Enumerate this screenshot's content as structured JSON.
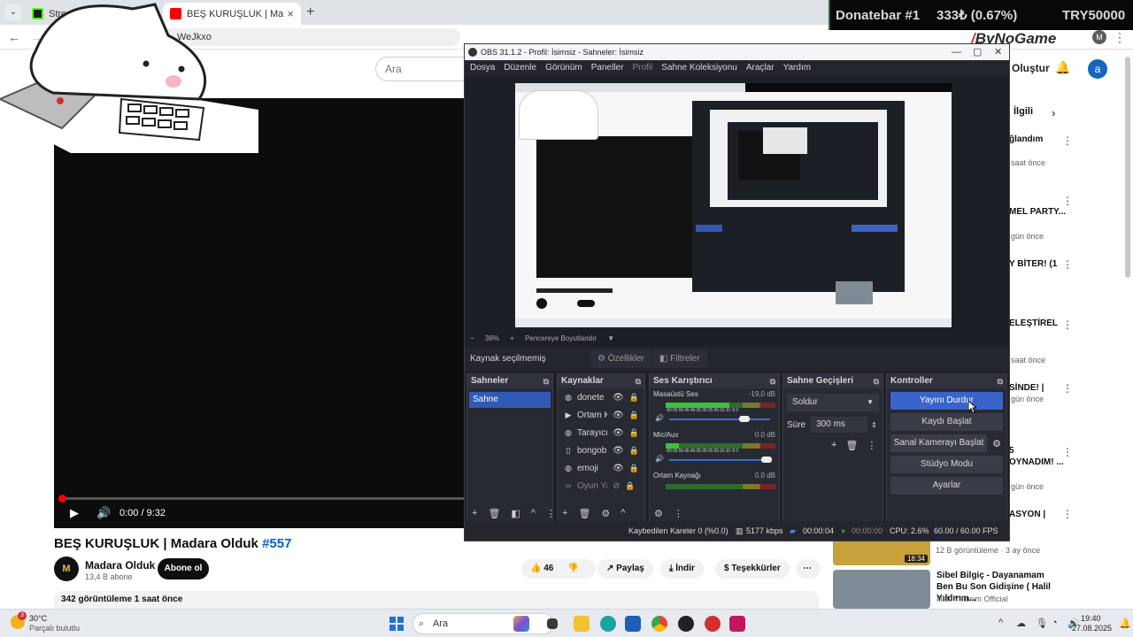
{
  "browser": {
    "tabs": [
      {
        "title": "Stream - Kick Dashboard"
      },
      {
        "title": "BEŞ KURUŞLUK | Madara Olduk"
      }
    ],
    "url_fragment": "WeJkxo"
  },
  "overlay": {
    "donate_label": "Donatebar #1",
    "donate_amount": "333₺ (0.67%)",
    "donate_goal": "TRY50000",
    "brand": "ByNoGame"
  },
  "youtube": {
    "search_placeholder": "Ara",
    "create_label": "Oluştur",
    "avatar_letter": "a",
    "video": {
      "time": "0:00 / 9:32",
      "title": "BEŞ KURUŞLUK | Madara Olduk ",
      "tag": "#557",
      "channel": "Madara Olduk",
      "subs": "13,4 B abone",
      "subscribe_label": "Abone ol",
      "likes": "46",
      "share": "Paylaş",
      "download": "İndir",
      "thanks": "Teşekkürler",
      "views": "342 görüntüleme  1 saat önce"
    },
    "sidebar": {
      "chip": "İlgili",
      "fragments": [
        "ğlandım",
        "saat önce",
        "MEL PARTY...",
        "gün önce",
        "Y BİTER! (1",
        "ELEŞTİREL",
        "saat önce",
        "SİNDE! |",
        "gün önce",
        "5",
        "OYNADIM! ...",
        "gün önce",
        "ASYON |"
      ],
      "rec1_duration": "18:34",
      "rec1_meta": "12 B görüntüleme · 3 ay önce",
      "rec2_title": "Sibel Bilgiç - Dayanamam Ben Bu Son Gidişine ( Halil Yıldırım...",
      "rec2_channel": "Halil Yıldırım Official"
    }
  },
  "obs": {
    "title": "OBS 31.1.2 - Profil: İsimsiz - Sahneler: İsimsiz",
    "menu": [
      "Dosya",
      "Düzenle",
      "Görünüm",
      "Paneller",
      "Profil",
      "Sahne Koleksiyonu",
      "Araçlar",
      "Yardım"
    ],
    "zoom": "38%",
    "fit_label": "Pencereye Boyutlandır",
    "no_source": "Kaynak seçilmemiş",
    "properties": "Özellikler",
    "filters": "Filtreler",
    "scenes_title": "Sahneler",
    "scene": "Sahne",
    "sources_title": "Kaynaklar",
    "sources": [
      "donete",
      "Ortam K",
      "Tarayıcı",
      "bongob",
      "emoji",
      "Oyun Ya"
    ],
    "mixer_title": "Ses Karıştırıcı",
    "mixer": [
      {
        "name": "Masaüstü Ses",
        "db": "-19,0 dB",
        "level": 0.58,
        "fader": 0.78
      },
      {
        "name": "Mic/Aux",
        "db": "0.0 dB",
        "level": 0.12,
        "fader": 0.98
      },
      {
        "name": "Ortam Kaynağı",
        "db": "0.0 dB",
        "level": 0.0,
        "fader": 0.98
      }
    ],
    "mixer_scale": "-60-55-50-45-40-35-30-25-20-15-10 -5  0",
    "transitions_title": "Sahne Geçişleri",
    "transition": "Soldur",
    "duration_label": "Süre",
    "duration": "300 ms",
    "controls_title": "Kontroller",
    "controls": [
      "Yayını Durdur",
      "Kaydı Başlat",
      "Sanal Kamerayı Başlat",
      "Stüdyo Modu",
      "Ayarlar"
    ],
    "status": {
      "dropped": "Kaybedilen Kareler 0 (%0.0)",
      "bitrate": "5177 kbps",
      "stream_time": "00:00:04",
      "rec_time": "00:00:00",
      "cpu": "CPU: 2.6%",
      "fps": "60.00 / 60.00 FPS"
    }
  },
  "taskbar": {
    "badge": "3",
    "temp": "30°C",
    "weather": "Parçalı bulutlu",
    "search": "Ara",
    "time": "19:40",
    "date": "27.08.2025"
  },
  "colors": {
    "obs_accent": "#3964c8",
    "yt_red": "#ff0000",
    "link_blue": "#065fd4"
  }
}
